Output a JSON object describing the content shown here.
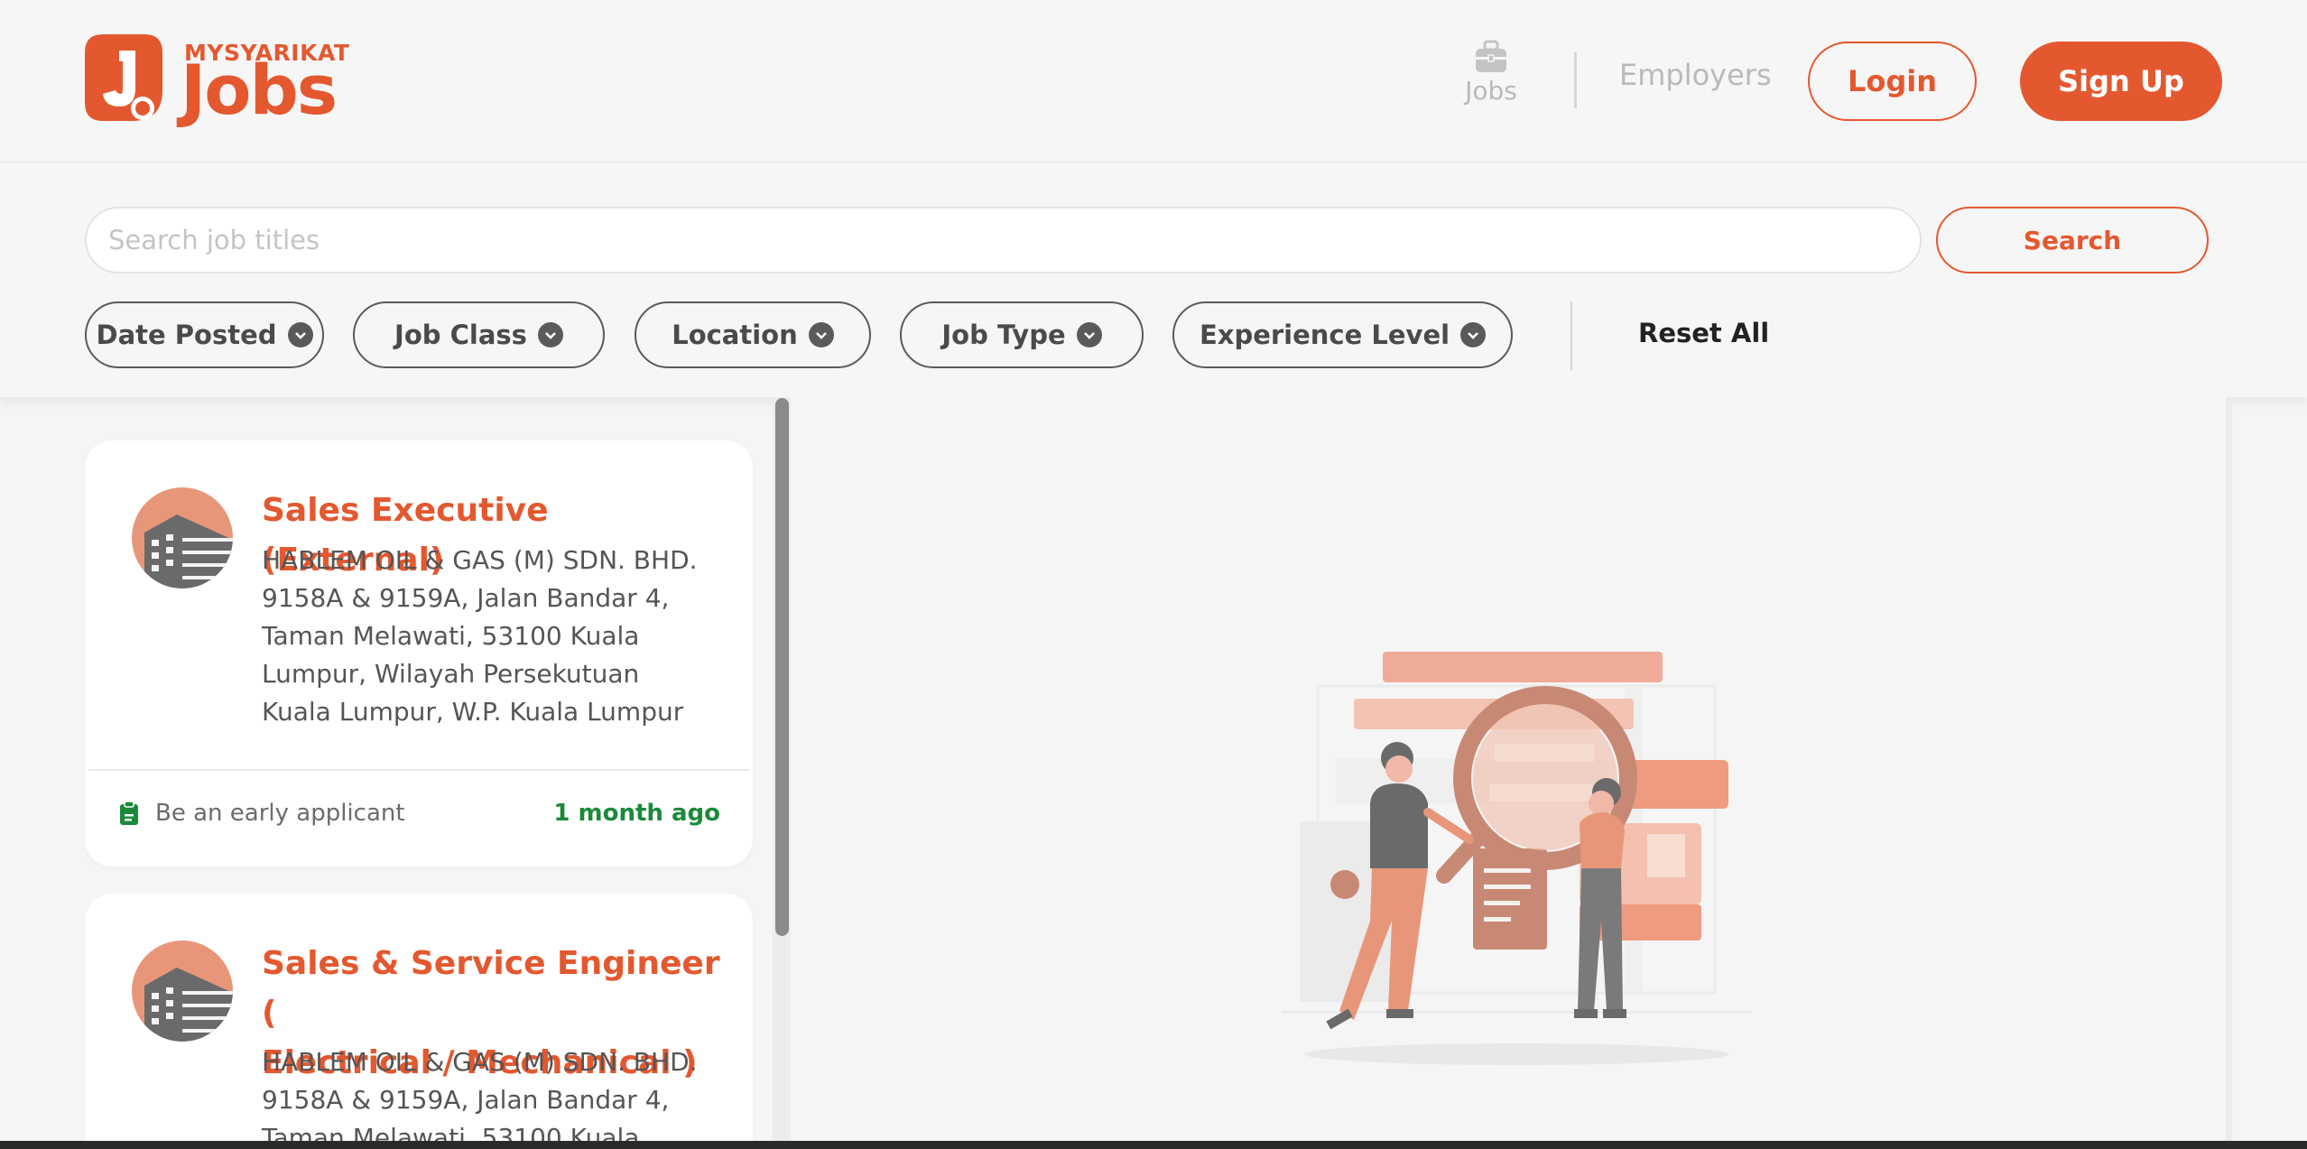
{
  "brand": {
    "small": "MYSYARIKAT",
    "big": "Jobs",
    "color": "#e4582f"
  },
  "nav": {
    "jobs_label": "Jobs",
    "employers_label": "Employers",
    "login_label": "Login",
    "signup_label": "Sign Up"
  },
  "search": {
    "placeholder": "Search job titles",
    "value": "",
    "button_label": "Search"
  },
  "filters": [
    {
      "label": "Date Posted"
    },
    {
      "label": "Job Class"
    },
    {
      "label": "Location"
    },
    {
      "label": "Job Type"
    },
    {
      "label": "Experience Level"
    }
  ],
  "reset_label": "Reset All",
  "jobs": [
    {
      "title": "Sales Executive (External)",
      "company_lines": [
        "HABLEM OIL & GAS (M) SDN. BHD.",
        "9158A & 9159A, Jalan Bandar 4,",
        "Taman Melawati, 53100 Kuala",
        "Lumpur, Wilayah Persekutuan",
        "Kuala Lumpur, W.P. Kuala Lumpur"
      ],
      "applicant_note": "Be an early applicant",
      "posted": "1 month ago"
    },
    {
      "title_lines": [
        "Sales & Service Engineer (",
        "Electrical / Mechanical )"
      ],
      "company_lines": [
        "HABLEM OIL & GAS (M) SDN. BHD.",
        "9158A & 9159A, Jalan Bandar 4,",
        "Taman Melawati, 53100 Kuala"
      ]
    }
  ],
  "colors": {
    "accent": "#e4582f",
    "posted_green": "#1a8a3a",
    "background": "#f5f5f5"
  },
  "icons": {
    "nav_jobs": "briefcase-icon",
    "filter_chevron": "chevron-down-icon",
    "company": "building-icon",
    "applicant": "clipboard-icon",
    "empty_state": "search-illustration"
  }
}
